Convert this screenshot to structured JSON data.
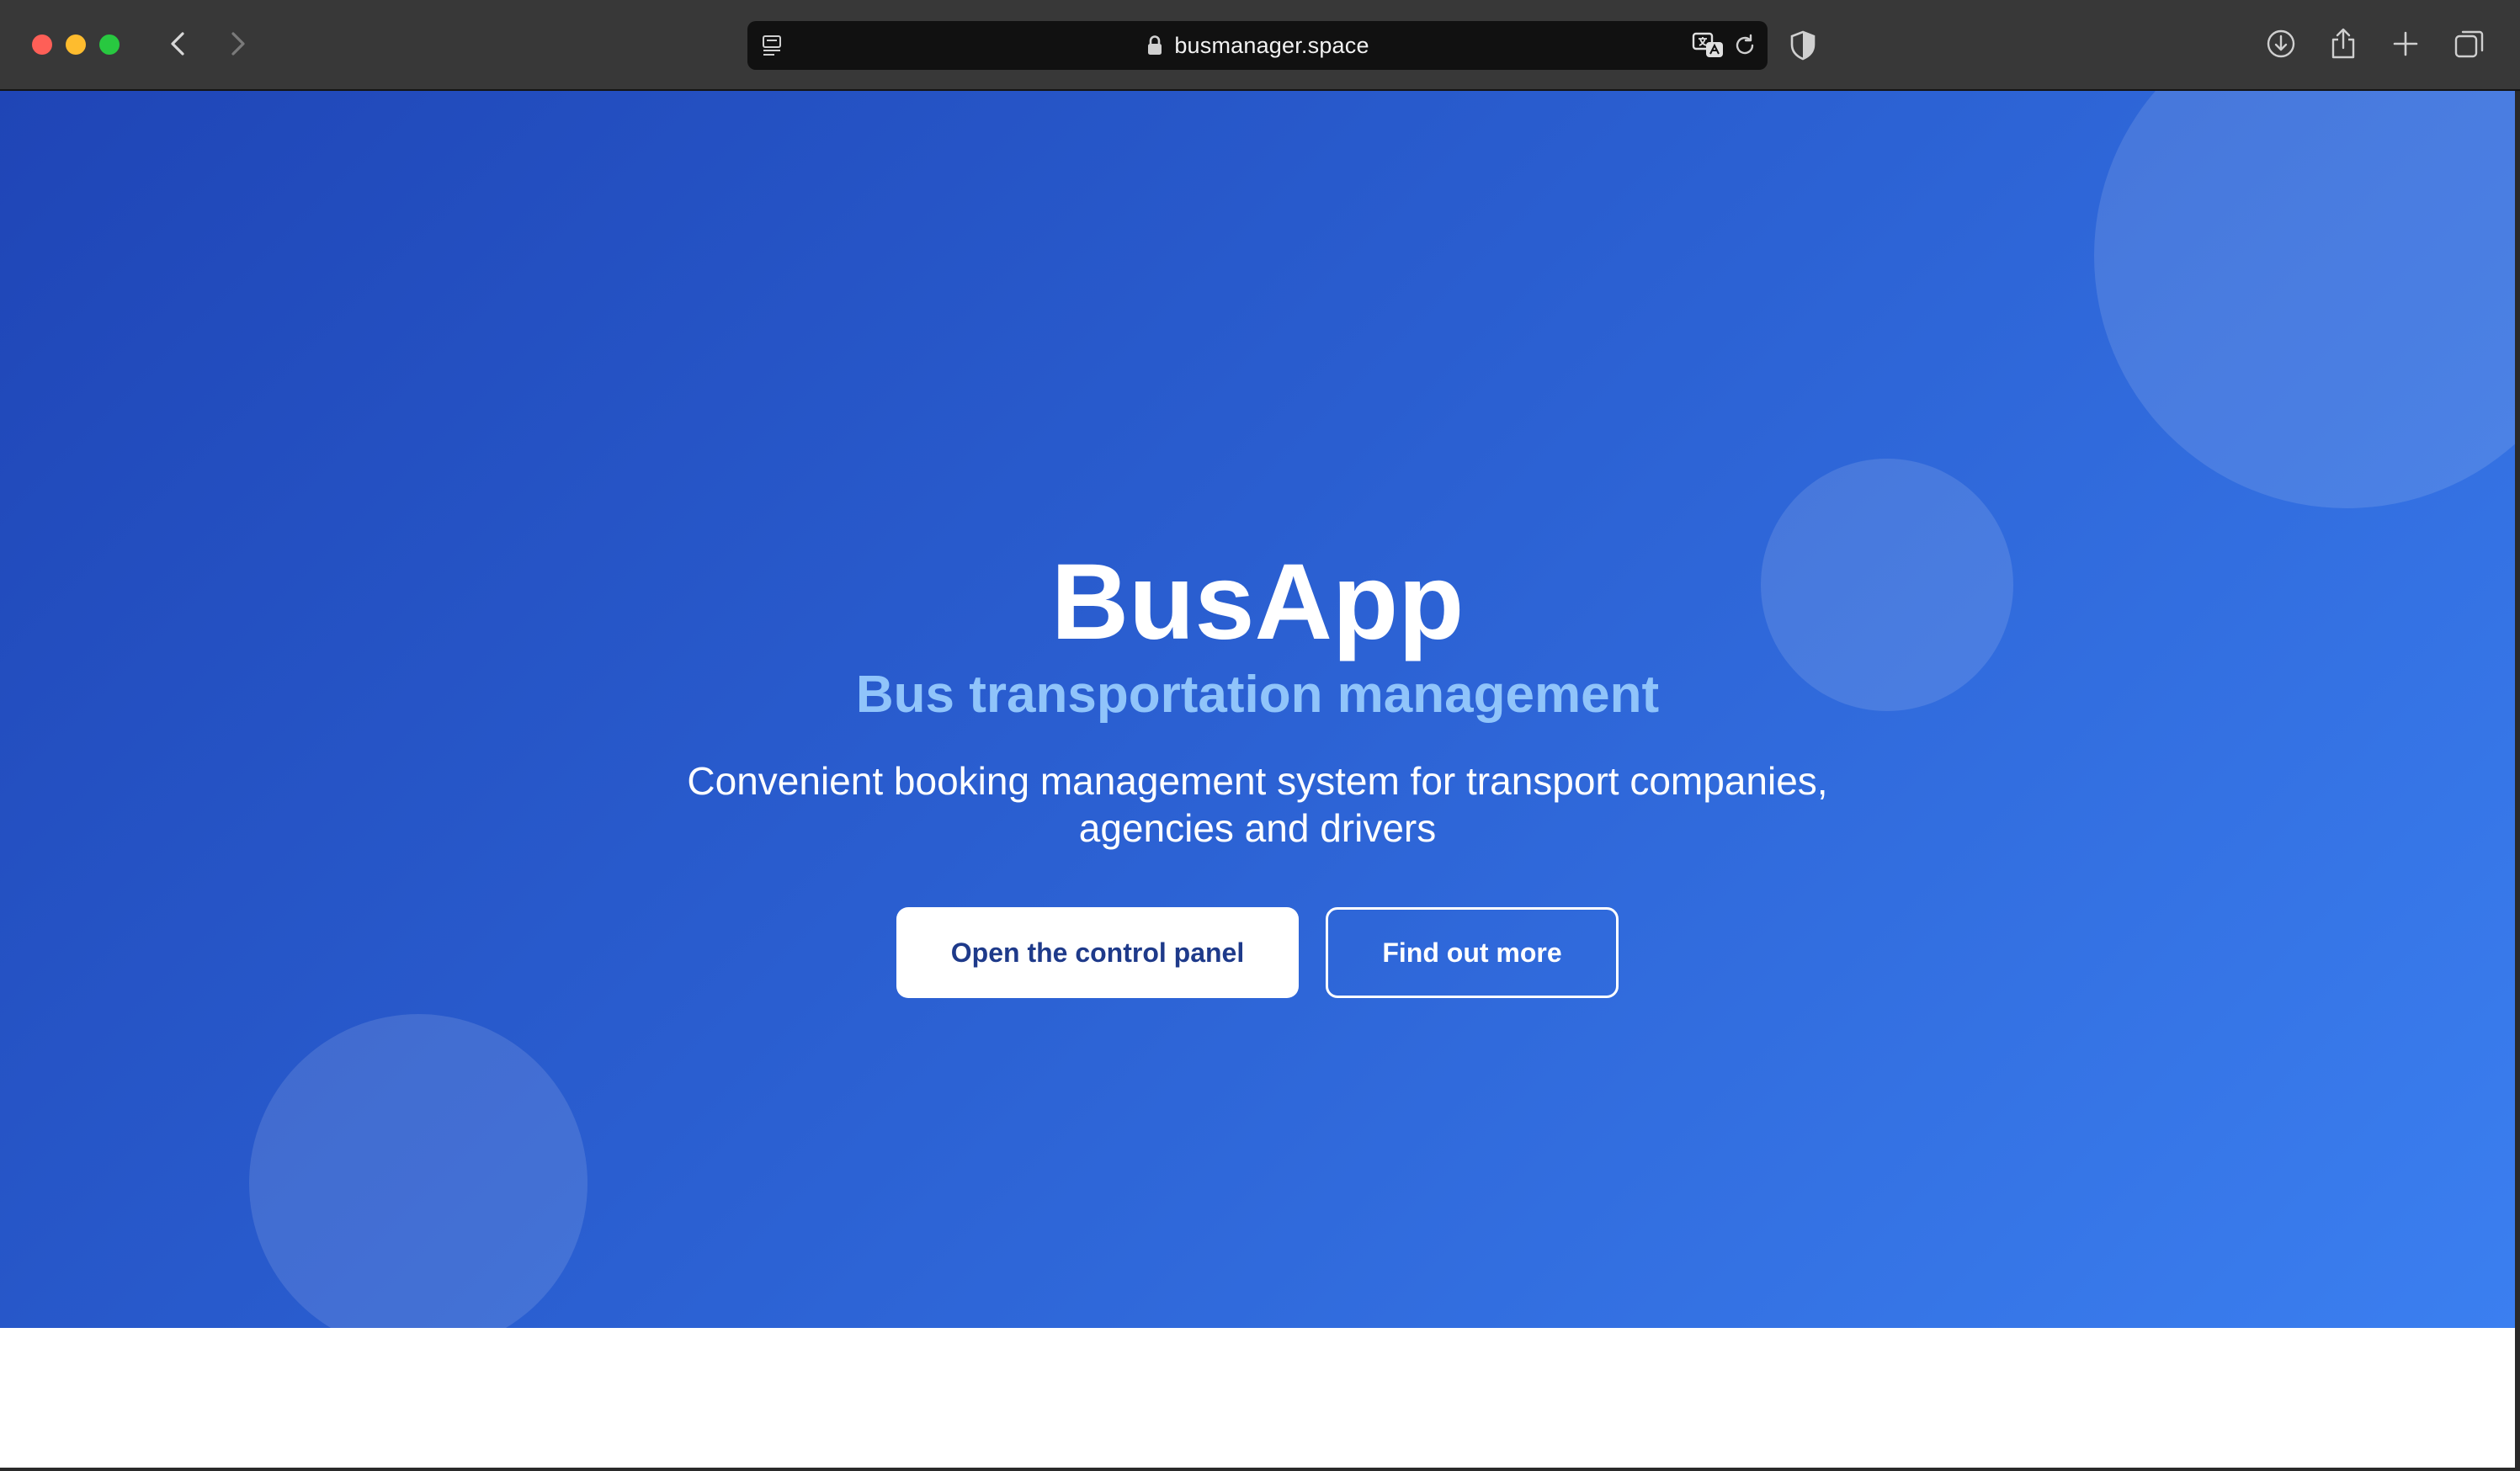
{
  "browser": {
    "url": "busmanager.space",
    "icons": {
      "back": "chevron-left-icon",
      "forward": "chevron-right-icon",
      "reader": "reader-mode-icon",
      "lock": "lock-icon",
      "translate": "translate-icon",
      "reload": "reload-icon",
      "privacy": "shield-icon",
      "download": "download-icon",
      "share": "share-icon",
      "new_tab": "plus-icon",
      "tab_overview": "tabs-overview-icon"
    }
  },
  "hero": {
    "title": "BusApp",
    "subtitle": "Bus transportation management",
    "description": "Convenient booking management system for transport companies, agencies and drivers",
    "primary_cta": "Open the control panel",
    "secondary_cta": "Find out more"
  },
  "colors": {
    "hero_gradient_start": "#1f45b6",
    "hero_gradient_end": "#3b7ff0",
    "subtitle": "#90c4fa",
    "primary_button_text": "#1e3a8a"
  }
}
